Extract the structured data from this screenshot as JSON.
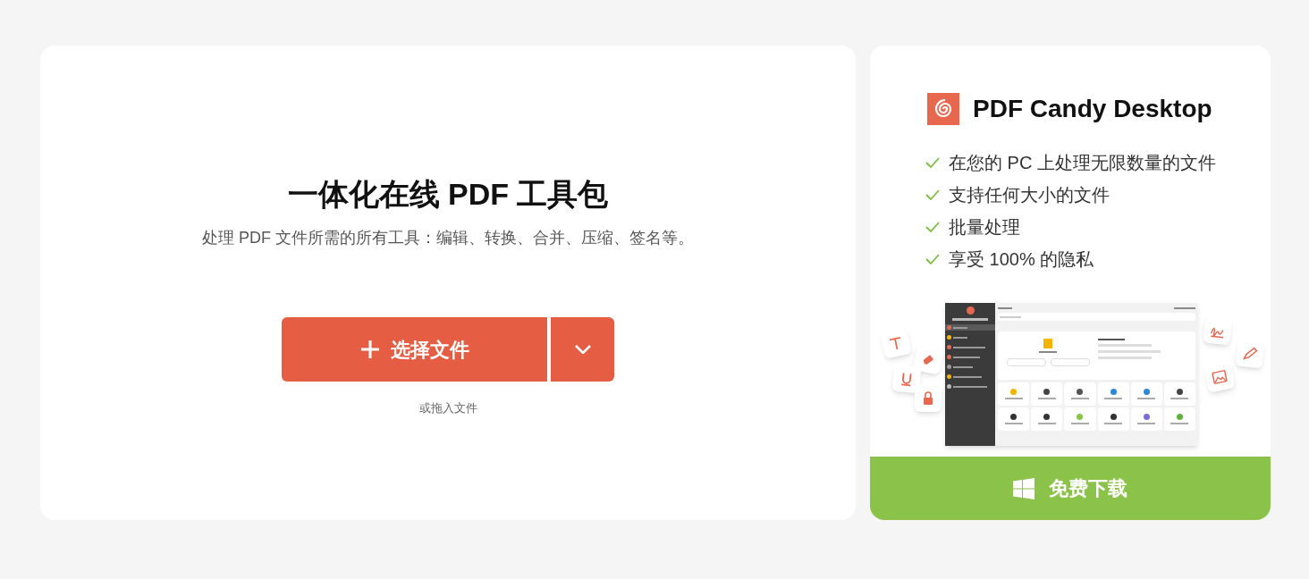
{
  "main": {
    "title": "一体化在线 PDF 工具包",
    "subtitle": "处理 PDF 文件所需的所有工具：编辑、转换、合并、压缩、签名等。",
    "upload_button": {
      "label": "选择文件"
    },
    "drop_hint": "或拖入文件"
  },
  "promo": {
    "title": "PDF Candy Desktop",
    "features": [
      "在您的 PC 上处理无限数量的文件",
      "支持任何大小的文件",
      "批量处理",
      "享受 100% 的隐私"
    ],
    "download_button": {
      "label": "免费下载"
    }
  }
}
